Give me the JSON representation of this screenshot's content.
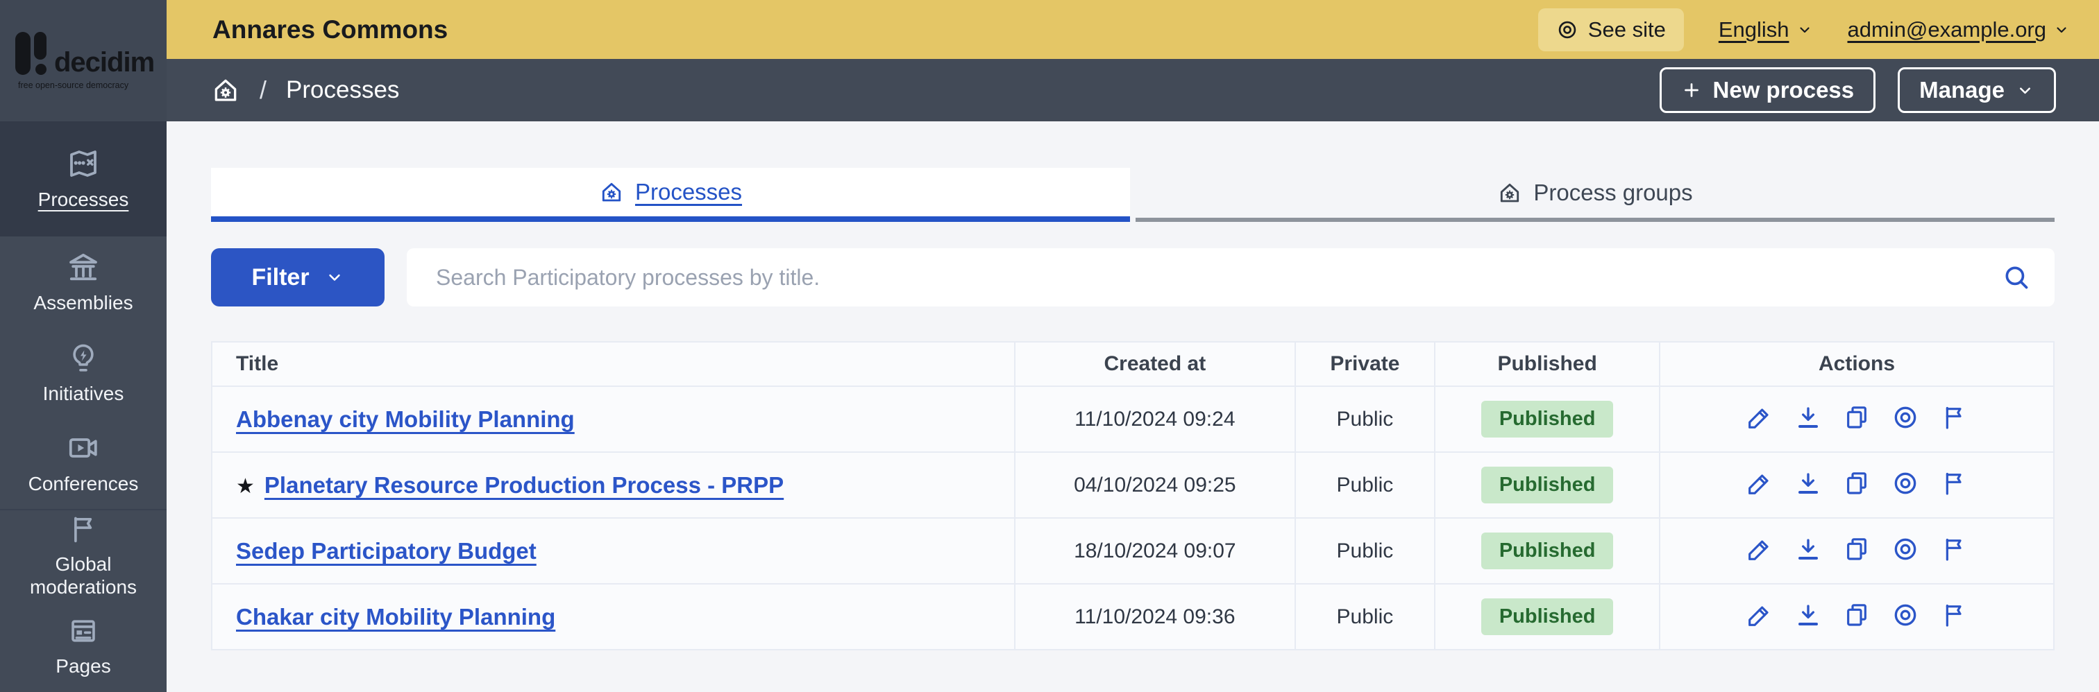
{
  "topbar": {
    "org_name": "Annares Commons",
    "see_site_label": "See site",
    "language_label": "English",
    "user_email": "admin@example.org"
  },
  "logo": {
    "brand": "decidim",
    "tagline": "free open-source democracy"
  },
  "subbar": {
    "breadcrumb_separator": "/",
    "breadcrumb_page": "Processes",
    "new_process_label": "New process",
    "manage_label": "Manage"
  },
  "sidebar": {
    "items": [
      {
        "label": "Processes",
        "icon": "treasure-map-icon",
        "active": true
      },
      {
        "label": "Assemblies",
        "icon": "bank-icon",
        "active": false
      },
      {
        "label": "Initiatives",
        "icon": "lightbulb-flash-icon",
        "active": false
      },
      {
        "label": "Conferences",
        "icon": "video-camera-icon",
        "active": false
      },
      {
        "label": "Global moderations",
        "icon": "flag-icon",
        "active": false
      },
      {
        "label": "Pages",
        "icon": "pages-icon",
        "active": false
      }
    ]
  },
  "tabs": [
    {
      "label": "Processes",
      "icon": "home-gear-icon",
      "active": true
    },
    {
      "label": "Process groups",
      "icon": "home-gear-icon",
      "active": false
    }
  ],
  "filters": {
    "filter_label": "Filter",
    "search_placeholder": "Search Participatory processes by title."
  },
  "table": {
    "columns": [
      "Title",
      "Created at",
      "Private",
      "Published",
      "Actions"
    ],
    "action_icons": [
      "edit-pencil-icon",
      "download-icon",
      "copy-icon",
      "preview-eye-icon",
      "flag-icon"
    ],
    "rows": [
      {
        "title": "Abbenay city Mobility Planning",
        "created_at": "11/10/2024 09:24",
        "private": "Public",
        "published": "Published"
      },
      {
        "star": "★",
        "title": "Planetary Resource Production Process - PRPP",
        "created_at": "04/10/2024 09:25",
        "private": "Public",
        "published": "Published"
      },
      {
        "title": "Sedep Participatory Budget",
        "created_at": "18/10/2024 09:07",
        "private": "Public",
        "published": "Published"
      },
      {
        "title": "Chakar city Mobility Planning",
        "created_at": "11/10/2024 09:36",
        "private": "Public",
        "published": "Published"
      }
    ]
  },
  "colors": {
    "topbar_gold": "#e4c666",
    "see_site_pill": "#edd88d",
    "slate_bar": "#424a57",
    "sidebar_active": "#333a48",
    "accent_blue": "#2b55c8",
    "filter_blue": "#2c55c4",
    "badge_green_bg": "#c9e8ca",
    "badge_green_text": "#266a30",
    "page_bg": "#f4f5f8",
    "table_bg": "#fafbfd",
    "table_border": "#e7ebf3"
  }
}
